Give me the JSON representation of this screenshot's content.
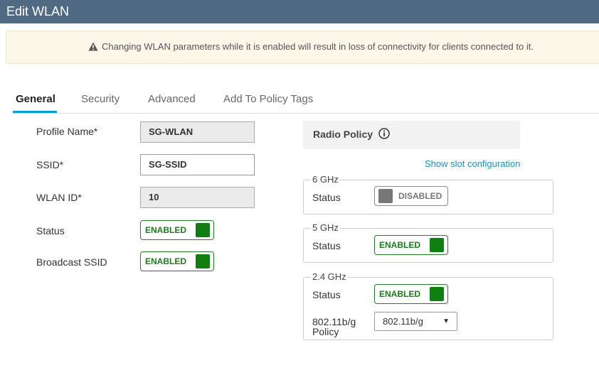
{
  "header": {
    "title": "Edit WLAN"
  },
  "alert": {
    "icon": "warning-icon",
    "text": "Changing WLAN parameters while it is enabled will result in loss of connectivity for clients connected to it."
  },
  "tabs": [
    {
      "label": "General",
      "active": true
    },
    {
      "label": "Security",
      "active": false
    },
    {
      "label": "Advanced",
      "active": false
    },
    {
      "label": "Add To Policy Tags",
      "active": false
    }
  ],
  "general": {
    "profile_name": {
      "label": "Profile Name*",
      "value": "SG-WLAN"
    },
    "ssid": {
      "label": "SSID*",
      "value": "SG-SSID"
    },
    "wlan_id": {
      "label": "WLAN ID*",
      "value": "10"
    },
    "status": {
      "label": "Status",
      "value": "ENABLED"
    },
    "broadcast_ssid": {
      "label": "Broadcast SSID",
      "value": "ENABLED"
    }
  },
  "radio_policy": {
    "title": "Radio Policy",
    "show_slot_link": "Show slot configuration",
    "band_6ghz": {
      "legend": "6 GHz",
      "status_label": "Status",
      "status_value": "DISABLED"
    },
    "band_5ghz": {
      "legend": "5 GHz",
      "status_label": "Status",
      "status_value": "ENABLED"
    },
    "band_24ghz": {
      "legend": "2.4 GHz",
      "status_label": "Status",
      "status_value": "ENABLED",
      "policy_label_line1": "802.11b/g",
      "policy_label_line2": "Policy",
      "policy_value": "802.11b/g"
    }
  },
  "colors": {
    "header_bg": "#4f6a82",
    "enabled_green": "#0f7f12",
    "link_blue": "#1a8fc9",
    "tab_accent": "#049fd9"
  }
}
